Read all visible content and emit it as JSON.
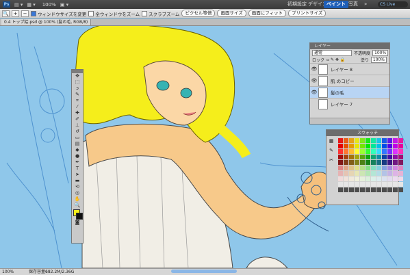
{
  "app": {
    "logo": "Ps",
    "zoom": "100%",
    "workspaces": [
      "初期設定",
      "デザイン",
      "ペイント",
      "写真"
    ],
    "active_workspace": "ペイント",
    "search": "CS Live"
  },
  "options": {
    "resize_windows": "ウィンドウサイズを変更",
    "all_windows": "全ウィンドウをズーム",
    "scrubby_zoom": "スクラブズーム",
    "actual_pixels": "ピクセル等倍",
    "print_size_1": "画面サイズ",
    "fit_screen": "画面にフィット",
    "print_size": "プリントサイズ"
  },
  "document": {
    "tab_label": "0.4 トップ絵.psd @ 100% (髪の毛, RGB/8)"
  },
  "layers": {
    "title": "レイヤー",
    "blend_mode": "通常",
    "opacity_label": "不透明度",
    "opacity": "100%",
    "lock_label": "ロック",
    "fill_label": "塗り",
    "fill": "100%",
    "items": [
      {
        "name": "レイヤー 8",
        "visible": true,
        "selected": false
      },
      {
        "name": "肌 のコピー",
        "visible": true,
        "selected": false
      },
      {
        "name": "髪の毛",
        "visible": true,
        "selected": true
      },
      {
        "name": "レイヤー 7",
        "visible": false,
        "selected": false
      }
    ]
  },
  "swatches": {
    "title": "スウォッチ"
  },
  "status": {
    "zoom": "100%",
    "doc_label": "保存容量：",
    "doc_size": "682.2M/2.36G"
  },
  "colors": {
    "canvas_bg": "#8fc7ea",
    "hair": "#f5ee1b",
    "skin": "#f7c98a",
    "dress": "#f4f4f0",
    "active_workspace": "#1f5fb8"
  }
}
